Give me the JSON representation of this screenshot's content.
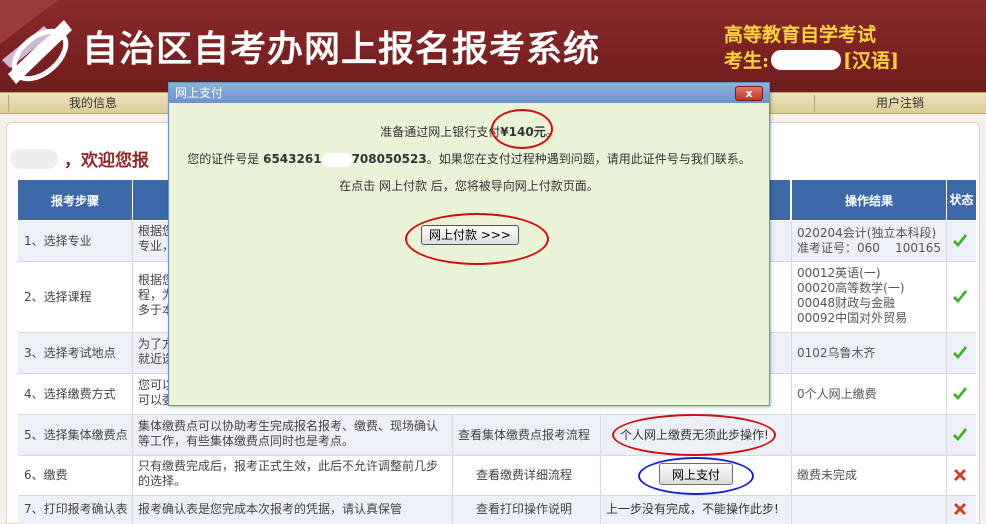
{
  "header": {
    "site_title": "自治区自考办网上报名报考系统",
    "exam_name": "高等教育自学考试",
    "candidate_label": "考生:",
    "candidate_language": "[汉语]"
  },
  "nav": {
    "my_info": "我的信息",
    "logout": "用户注销"
  },
  "welcome": {
    "text": "，欢迎您报"
  },
  "table": {
    "headers": {
      "step": "报考步骤",
      "result": "操作结果",
      "status": "状态"
    },
    "rows": [
      {
        "step": "1、选择专业",
        "desc": "根据您\n专业，",
        "result": "020204会计(独立本科段)\n准考证号：060    100165",
        "status": "done"
      },
      {
        "step": "2、选择课程",
        "desc": "根据您\n程，为\n多于本",
        "result": "00012英语(一)\n00020高等数学(一)\n00048财政与金融\n00092中国对外贸易",
        "status": "done"
      },
      {
        "step": "3、选择考试地点",
        "desc": "为了方\n就近选",
        "result": "0102乌鲁木齐",
        "status": "done"
      },
      {
        "step": "4、选择缴费方式",
        "desc": "您可以\n可以委",
        "result": "0个人网上缴费",
        "status": "done"
      },
      {
        "step": "5、选择集体缴费点",
        "desc": "集体缴费点可以协助考生完成报名报考、缴费、现场确认等工作，有些集体缴费点同时也是考点。",
        "link": "查看集体缴费点报考流程",
        "action_text": "个人网上缴费无须此步操作!",
        "result": "",
        "status": "done"
      },
      {
        "step": "6、缴费",
        "desc": "只有缴费完成后，报考正式生效，此后不允许调整前几步的选择。",
        "link": "查看缴费详细流程",
        "action_button": "网上支付",
        "result": "缴费未完成",
        "status": "not-done"
      },
      {
        "step": "7、打印报考确认表",
        "desc": "报考确认表是您完成本次报考的凭据，请认真保管",
        "link": "查看打印操作说明",
        "action_text": "上一步没有完成，不能操作此步!",
        "result": "",
        "status": "not-done"
      }
    ]
  },
  "modal": {
    "title": "网上支付",
    "close_label": "x",
    "line1_prefix": "准备通过网上银行支付",
    "line1_amount": "¥140元",
    "line1_suffix": "。",
    "line2_prefix": "您的证件号是",
    "line2_id_start": "6543261",
    "line2_id_end": "708050523",
    "line2_suffix": "。如果您在支付过程种遇到问题，请用此证件号与我们联系。",
    "line3": "在点击 网上付款 后，您将被导向网上付款页面。",
    "pay_button": "网上付款 >>>"
  },
  "colors": {
    "header_bg": "#7b2222",
    "title_yellow": "#ffd23f",
    "table_header": "#3d69a8",
    "modal_bg": "#eaf3d6",
    "annotation_red": "#d01010",
    "annotation_blue": "#1a24c8",
    "check_green": "#3fae2a",
    "cross_red": "#d23b2b"
  }
}
